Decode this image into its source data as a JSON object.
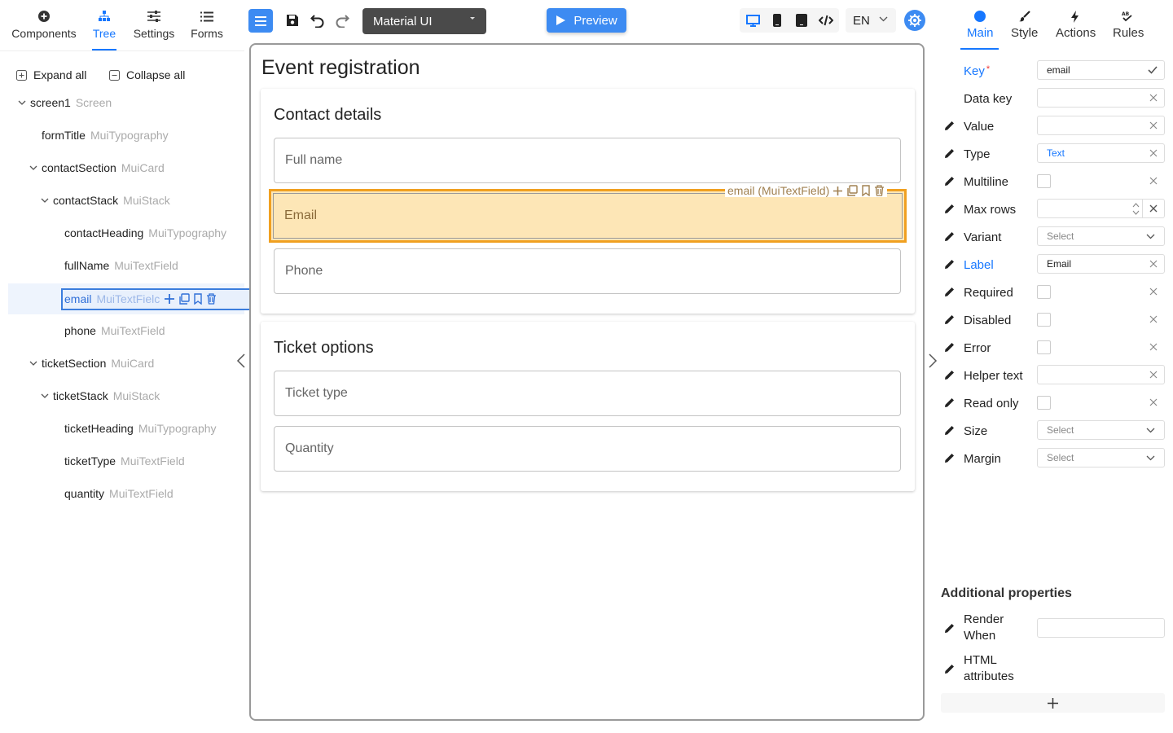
{
  "left_tabs": [
    {
      "label": "Components",
      "icon": "plus-circle-icon"
    },
    {
      "label": "Tree",
      "icon": "tree-icon",
      "active": true
    },
    {
      "label": "Settings",
      "icon": "sliders-icon"
    },
    {
      "label": "Forms",
      "icon": "list-icon"
    }
  ],
  "tree_actions": {
    "expand_all": "Expand all",
    "collapse_all": "Collapse all"
  },
  "tree": [
    {
      "name": "screen1",
      "type": "Screen"
    },
    {
      "name": "formTitle",
      "type": "MuiTypography"
    },
    {
      "name": "contactSection",
      "type": "MuiCard"
    },
    {
      "name": "contactStack",
      "type": "MuiStack"
    },
    {
      "name": "contactHeading",
      "type": "MuiTypography"
    },
    {
      "name": "fullName",
      "type": "MuiTextField"
    },
    {
      "name": "email",
      "type": "MuiTextFielc",
      "selected": true
    },
    {
      "name": "phone",
      "type": "MuiTextField"
    },
    {
      "name": "ticketSection",
      "type": "MuiCard"
    },
    {
      "name": "ticketStack",
      "type": "MuiStack"
    },
    {
      "name": "ticketHeading",
      "type": "MuiTypography"
    },
    {
      "name": "ticketType",
      "type": "MuiTextField"
    },
    {
      "name": "quantity",
      "type": "MuiTextField"
    }
  ],
  "toolbar": {
    "theme": "Material UI",
    "preview": "Preview",
    "language": "EN",
    "accent_color": "#3d8bf2"
  },
  "canvas": {
    "form_title": "Event registration",
    "contact_heading": "Contact details",
    "ticket_heading": "Ticket options",
    "fields": {
      "full_name": "Full name",
      "email": "Email",
      "phone": "Phone",
      "ticket_type": "Ticket type",
      "quantity": "Quantity"
    },
    "selected_tag": "email (MuiTextField)",
    "highlight_color": "#f0a020"
  },
  "right_tabs": [
    {
      "label": "Main",
      "icon": "circle-icon",
      "active": true
    },
    {
      "label": "Style",
      "icon": "brush-icon"
    },
    {
      "label": "Actions",
      "icon": "lightning-icon"
    },
    {
      "label": "Rules",
      "icon": "rules-icon"
    }
  ],
  "properties": {
    "key": {
      "label": "Key",
      "value": "email"
    },
    "data_key": {
      "label": "Data key",
      "value": ""
    },
    "value": {
      "label": "Value",
      "value": ""
    },
    "type": {
      "label": "Type",
      "value": "Text"
    },
    "multiline": {
      "label": "Multiline"
    },
    "max_rows": {
      "label": "Max rows",
      "value": ""
    },
    "variant": {
      "label": "Variant",
      "value": "Select"
    },
    "label": {
      "label": "Label",
      "value": "Email"
    },
    "required": {
      "label": "Required"
    },
    "disabled": {
      "label": "Disabled"
    },
    "error": {
      "label": "Error"
    },
    "helper_text": {
      "label": "Helper text",
      "value": ""
    },
    "read_only": {
      "label": "Read only"
    },
    "size": {
      "label": "Size",
      "value": "Select"
    },
    "margin": {
      "label": "Margin",
      "value": "Select"
    }
  },
  "additional": {
    "title": "Additional properties",
    "render_when": {
      "label_1": "Render",
      "label_2": "When",
      "value": ""
    },
    "html_attributes": {
      "label_1": "HTML",
      "label_2": "attributes"
    }
  }
}
